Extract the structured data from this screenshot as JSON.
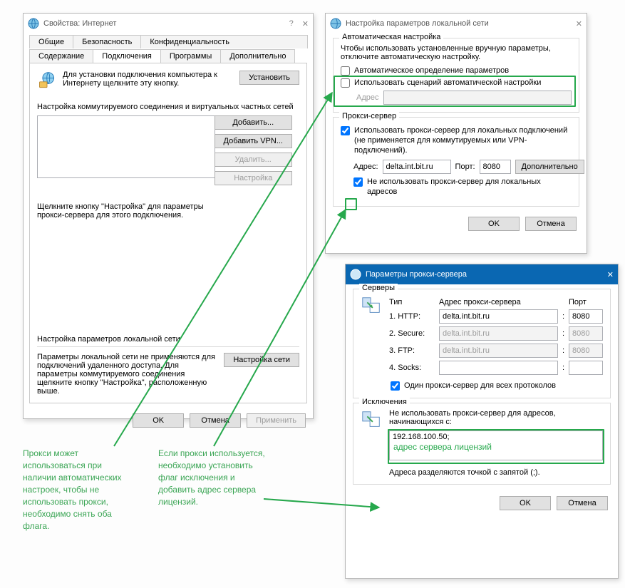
{
  "dlg1": {
    "title": "Свойства: Интернет",
    "help_glyph": "?",
    "close_glyph": "✕",
    "tabs_row1": [
      "Общие",
      "Безопасность",
      "Конфиденциальность"
    ],
    "tabs_row2": [
      "Содержание",
      "Подключения",
      "Программы",
      "Дополнительно"
    ],
    "active_tab_index": 1,
    "install_text": "Для установки подключения компьютера к Интернету щелкните эту кнопку.",
    "install_btn": "Установить",
    "dial_section": "Настройка коммутируемого соединения и виртуальных частных сетей",
    "btn_add": "Добавить...",
    "btn_add_vpn": "Добавить VPN...",
    "btn_remove": "Удалить...",
    "btn_settings": "Настройка",
    "proxy_hint": "Щелкните кнопку \"Настройка\" для параметры прокси-сервера для этого подключения.",
    "lan_title": "Настройка параметров локальной сети",
    "lan_text": "Параметры локальной сети не применяются для подключений удаленного доступа. Для параметры коммутируемого соединения щелкните кнопку \"Настройка\", расположенную выше.",
    "lan_btn": "Настройка сети",
    "ok": "OK",
    "cancel": "Отмена",
    "apply": "Применить"
  },
  "dlg2": {
    "title": "Настройка параметров локальной сети",
    "close_glyph": "✕",
    "auto_group": "Автоматическая настройка",
    "auto_text": "Чтобы использовать установленные вручную параметры, отключите автоматическую настройку.",
    "auto_detect": "Автоматическое определение параметров",
    "use_script": "Использовать сценарий автоматической настройки",
    "addr_label": "Адрес",
    "addr_value": "",
    "proxy_group": "Прокси-сервер",
    "use_proxy": "Использовать прокси-сервер для локальных подключений (не применяется для коммутируемых или VPN-подключений).",
    "addr2_label": "Адрес:",
    "proxy_addr": "delta.int.bit.ru",
    "port_label": "Порт:",
    "proxy_port": "8080",
    "more": "Дополнительно",
    "bypass_local": "Не использовать прокси-сервер для локальных адресов",
    "ok": "OK",
    "cancel": "Отмена"
  },
  "dlg3": {
    "title": "Параметры прокси-сервера",
    "close_glyph": "✕",
    "servers_group": "Серверы",
    "col_type": "Тип",
    "col_address": "Адрес прокси-сервера",
    "col_port": "Порт",
    "rows": [
      {
        "label": "1. HTTP:",
        "addr": "delta.int.bit.ru",
        "port": "8080",
        "enabled": true
      },
      {
        "label": "2. Secure:",
        "addr": "delta.int.bit.ru",
        "port": "8080",
        "enabled": false
      },
      {
        "label": "3. FTP:",
        "addr": "delta.int.bit.ru",
        "port": "8080",
        "enabled": false
      },
      {
        "label": "4. Socks:",
        "addr": "",
        "port": "",
        "enabled": true
      }
    ],
    "same_label": "Один прокси-сервер для всех протоколов",
    "except_group": "Исключения",
    "except_text": "Не использовать прокси-сервер для адресов, начинающихся с:",
    "except_value": "192.168.100.50;",
    "except_hint": "адрес сервера лицензий",
    "sep_text": "Адреса разделяются точкой с запятой (;).",
    "ok": "OK",
    "cancel": "Отмена"
  },
  "notes": {
    "left": "Прокси может использоваться при наличии автоматических настроек, чтобы не использовать прокси, необходимо снять оба флага.",
    "mid": "Если прокси используется, необходимо установить флаг исключения и добавить адрес сервера лицензий."
  }
}
